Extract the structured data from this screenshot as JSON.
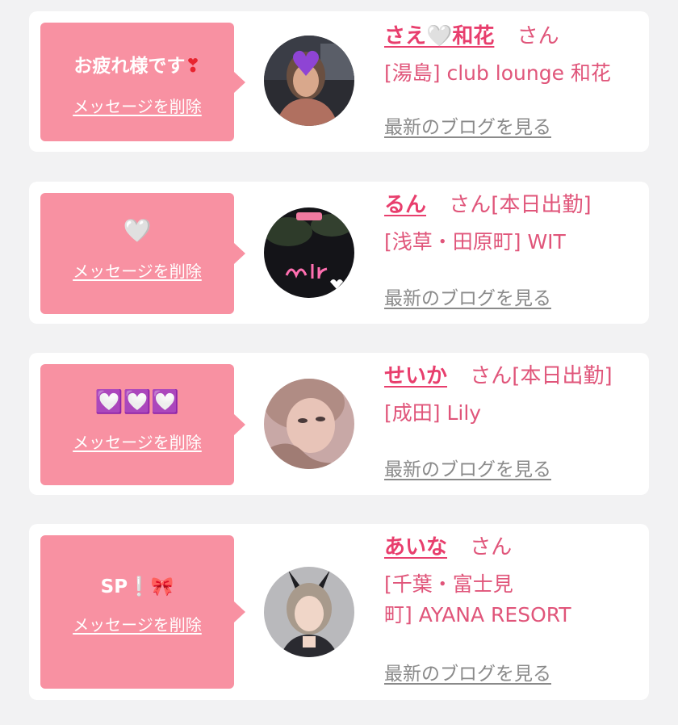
{
  "colors": {
    "background": "#f2f2f3",
    "card": "#ffffff",
    "bubble": "#f891a2",
    "name": "#e83e6d",
    "text_pink": "#e0557a",
    "link_gray": "#8a8a8a"
  },
  "items": [
    {
      "message": "お疲れ様です",
      "message_emoji": "❣",
      "delete_label": "メッセージを削除",
      "name": "さえ🤍和花",
      "honorific": "さん",
      "status": "",
      "shop": "[湯島] club lounge 和花",
      "blog_label": "最新のブログを見る"
    },
    {
      "message": "",
      "message_emoji": "🤍",
      "delete_label": "メッセージを削除",
      "name": "るん",
      "honorific": "さん",
      "status": "[本日出勤]",
      "shop": "[浅草・田原町] WIT",
      "blog_label": "最新のブログを見る"
    },
    {
      "message": "",
      "message_emoji": "💟💟💟",
      "delete_label": "メッセージを削除",
      "name": "せいか",
      "honorific": "さん",
      "status": "[本日出勤]",
      "shop": "[成田] Lily",
      "blog_label": "最新のブログを見る"
    },
    {
      "message": "SP❕",
      "message_emoji": "🎀",
      "delete_label": "メッセージを削除",
      "name": "あいな",
      "honorific": "さん",
      "status": "",
      "shop_line1": "[千葉・富士見",
      "shop_line2": "町] AYANA RESORT",
      "blog_label": "最新のブログを見る"
    }
  ]
}
